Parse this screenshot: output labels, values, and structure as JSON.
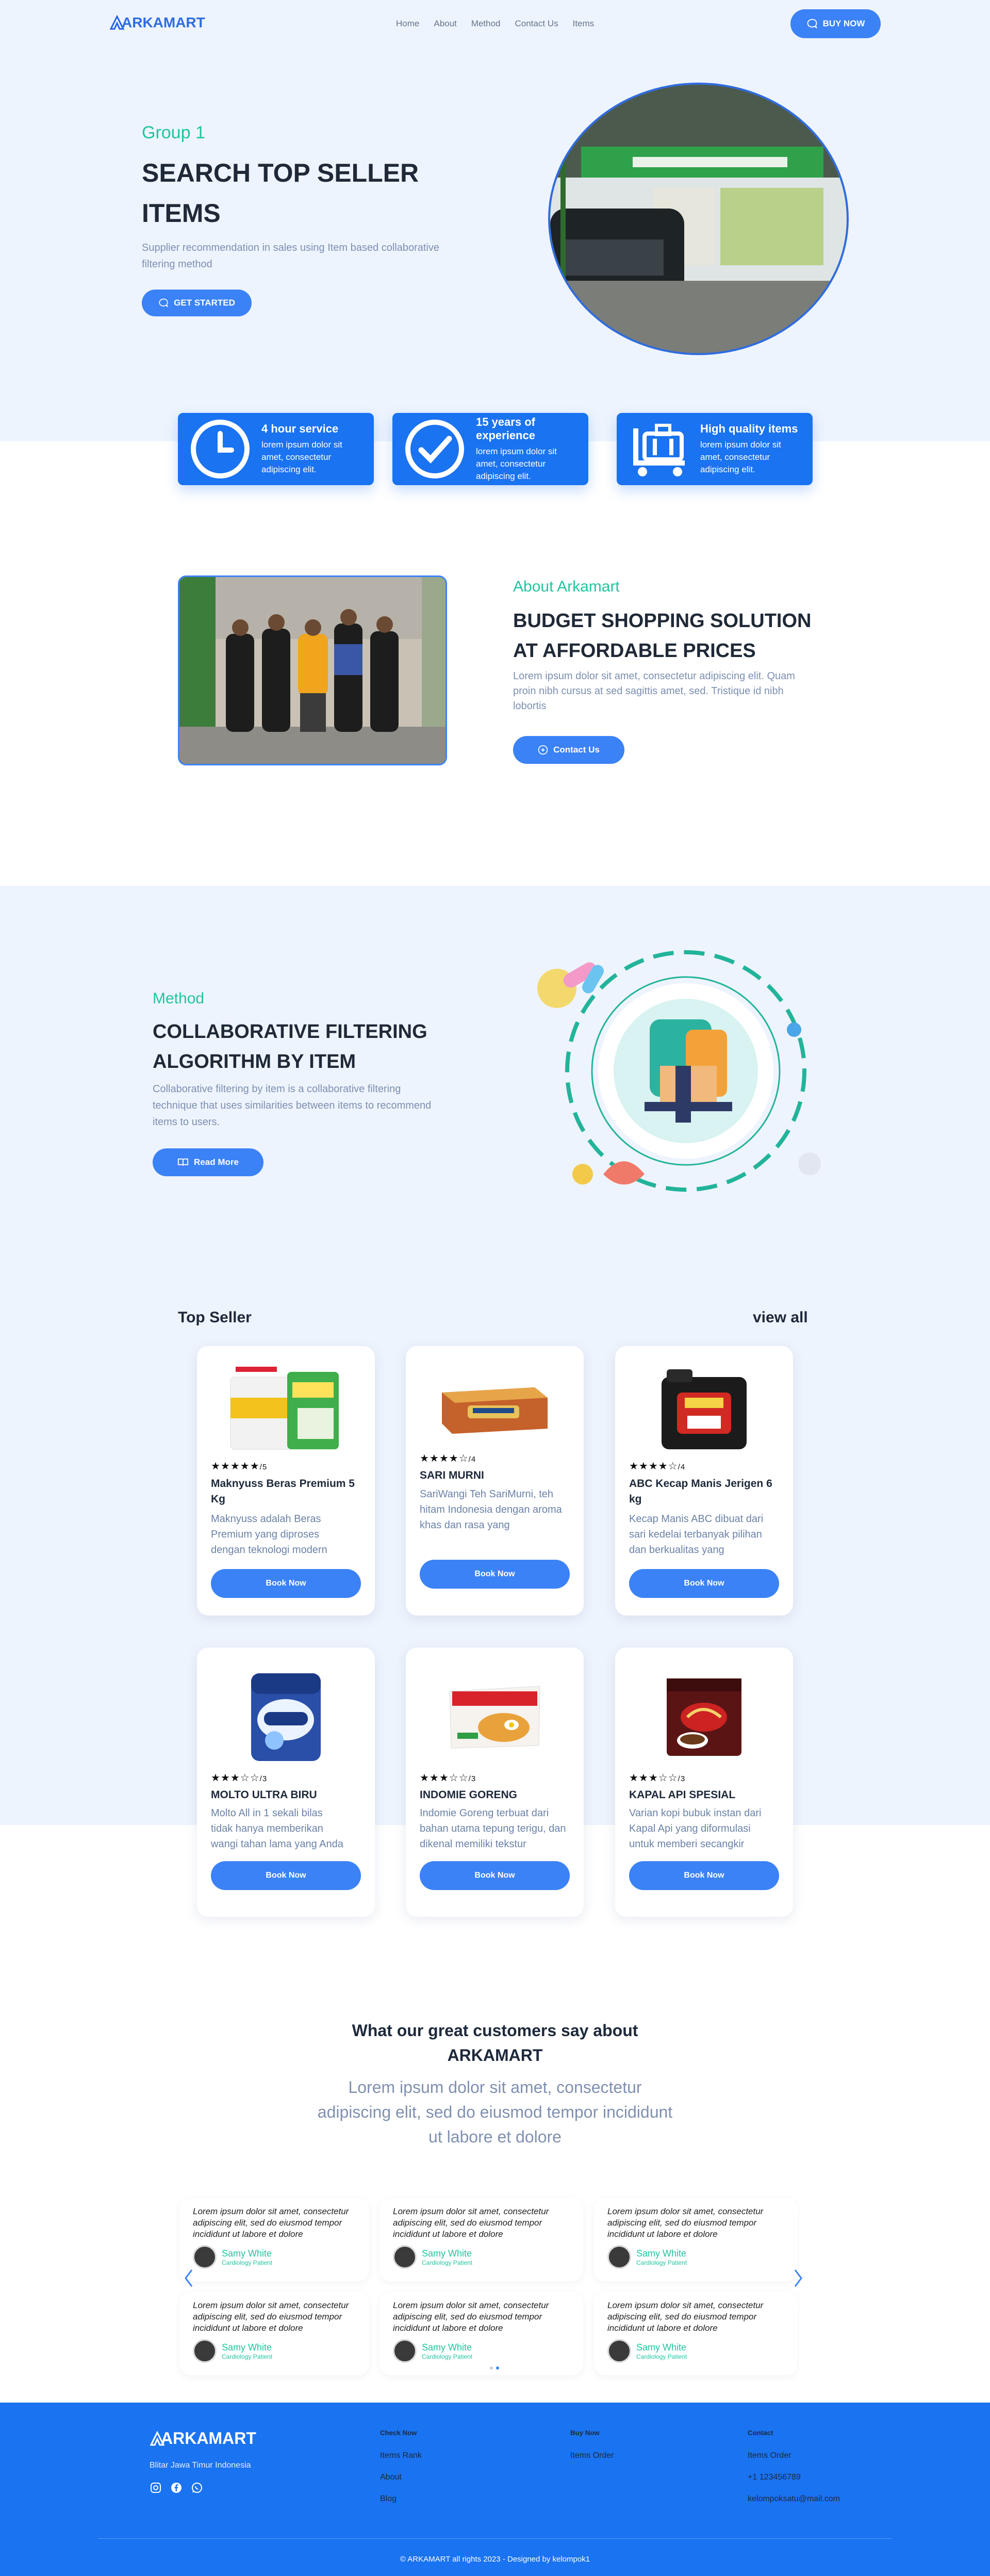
{
  "nav": {
    "logo": "ARKAMART",
    "links": [
      "Home",
      "About",
      "Method",
      "Contact Us",
      "Items"
    ],
    "buy": "BUY NOW"
  },
  "hero": {
    "eyebrow": "Group 1",
    "title1": "SEARCH TOP SELLER",
    "title2": "ITEMS",
    "subtitle": "Supplier recommendation in sales using Item based collaborative filtering method",
    "cta": "GET STARTED",
    "image": "storefront-photo"
  },
  "features": [
    {
      "icon": "clock-icon",
      "title": "4 hour service",
      "text": "lorem ipsum dolor sit amet, consectetur adipiscing elit."
    },
    {
      "icon": "check-circle-icon",
      "title": "15 years of experience",
      "text": "lorem ipsum dolor sit amet, consectetur adipiscing elit."
    },
    {
      "icon": "luggage-icon",
      "title": "High quality items",
      "text": "lorem ipsum dolor sit amet, consectetur adipiscing elit."
    }
  ],
  "about": {
    "eyebrow": "About Arkamart",
    "title1": "BUDGET SHOPPING SOLUTION",
    "title2": "AT AFFORDABLE PRICES",
    "text": "Lorem ipsum dolor sit amet, consectetur adipiscing elit. Quam proin nibh cursus at sed sagittis amet, sed. Tristique id nibh lobortis",
    "cta": "Contact Us"
  },
  "method": {
    "eyebrow": "Method",
    "title1": "COLLABORATIVE FILTERING",
    "title2": "ALGORITHM BY ITEM",
    "text": "Collaborative filtering by item is a collaborative filtering technique that uses similarities between items to recommend items to users.",
    "cta": "Read More"
  },
  "topseller": {
    "heading": "Top Seller",
    "viewall": "view all",
    "book": "Book Now",
    "products": [
      {
        "stars": "★★★★★",
        "rating": "/5",
        "name": "Maknyuss Beras Premium 5 Kg",
        "desc": "Maknyuss adalah Beras Premium yang diproses dengan teknologi modern",
        "icon": "rice-bag-icon"
      },
      {
        "stars": "★★★★☆",
        "rating": "/4",
        "name": "SARI MURNI",
        "desc": "SariWangi Teh SariMurni, teh hitam Indonesia dengan aroma khas dan rasa yang",
        "icon": "tea-box-icon"
      },
      {
        "stars": "★★★★☆",
        "rating": "/4",
        "name": "ABC Kecap Manis Jerigen 6 kg",
        "desc": "Kecap Manis ABC dibuat dari sari kedelai terbanyak pilihan dan berkualitas yang",
        "icon": "soy-sauce-jerrycan-icon"
      },
      {
        "stars": "★★★☆☆",
        "rating": "/3",
        "name": "MOLTO ULTRA BIRU",
        "desc": "Molto All in 1 sekali bilas tidak hanya memberikan wangi tahan lama yang Anda",
        "icon": "molto-pouch-icon"
      },
      {
        "stars": "★★★☆☆",
        "rating": "/3",
        "name": "INDOMIE GORENG",
        "desc": "Indomie Goreng terbuat dari bahan utama tepung terigu, dan dikenal memiliki tekstur",
        "icon": "noodle-pack-icon"
      },
      {
        "stars": "★★★☆☆",
        "rating": "/3",
        "name": "KAPAL API SPESIAL",
        "desc": "Varian kopi bubuk instan dari Kapal Api yang diformulasi untuk memberi secangkir",
        "icon": "coffee-pack-icon"
      }
    ]
  },
  "testimonials": {
    "title1": "What our great customers say about",
    "title2": "ARKAMART",
    "subtitle": "Lorem ipsum dolor sit amet, consectetur adipiscing elit, sed do eiusmod tempor incididunt ut labore et dolore",
    "quote": "Lorem ipsum dolor sit amet, consectetur adipiscing elit, sed do eiusmod tempor incididunt ut labore et dolore",
    "name": "Samy White",
    "role": "Cardiology Patient"
  },
  "footer": {
    "logo": "ARKAMART",
    "address": "Blitar Jawa Timur Indonesia",
    "col1": {
      "title": "Check Now",
      "links": [
        "Items Rank",
        "About",
        "Blog"
      ]
    },
    "col2": {
      "title": "Buy Now",
      "links": [
        "Items Order"
      ]
    },
    "col3": {
      "title": "Contact",
      "links": [
        "Items Order",
        "+1 123456789",
        "kelompoksatu@mail.com"
      ]
    },
    "copyright": "© ARKAMART all rights 2023 - Designed by kelompok1"
  },
  "colors": {
    "primary": "#1a73f0",
    "accent": "#22c4a0",
    "hero_bg": "#eef4fd"
  }
}
